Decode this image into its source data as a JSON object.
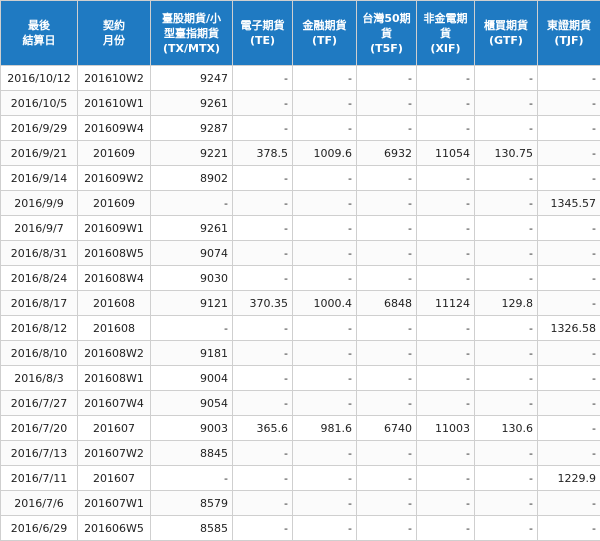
{
  "headers": [
    {
      "lines": [
        "最後",
        "結算日"
      ]
    },
    {
      "lines": [
        "契約",
        "月份"
      ]
    },
    {
      "lines": [
        "臺股期貨/小",
        "型臺指期貨",
        "(TX/MTX)"
      ]
    },
    {
      "lines": [
        "電子期貨",
        "(TE)"
      ]
    },
    {
      "lines": [
        "金融期貨",
        "(TF)"
      ]
    },
    {
      "lines": [
        "台灣50期",
        "貨",
        "(T5F)"
      ]
    },
    {
      "lines": [
        "非金電期",
        "貨",
        "(XIF)"
      ]
    },
    {
      "lines": [
        "櫃買期貨",
        "(GTF)"
      ]
    },
    {
      "lines": [
        "東證期貨",
        "(TJF)"
      ]
    }
  ],
  "rows": [
    [
      "2016/10/12",
      "201610W2",
      "9247",
      "-",
      "-",
      "-",
      "-",
      "-",
      "-"
    ],
    [
      "2016/10/5",
      "201610W1",
      "9261",
      "-",
      "-",
      "-",
      "-",
      "-",
      "-"
    ],
    [
      "2016/9/29",
      "201609W4",
      "9287",
      "-",
      "-",
      "-",
      "-",
      "-",
      "-"
    ],
    [
      "2016/9/21",
      "201609",
      "9221",
      "378.5",
      "1009.6",
      "6932",
      "11054",
      "130.75",
      "-"
    ],
    [
      "2016/9/14",
      "201609W2",
      "8902",
      "-",
      "-",
      "-",
      "-",
      "-",
      "-"
    ],
    [
      "2016/9/9",
      "201609",
      "-",
      "-",
      "-",
      "-",
      "-",
      "-",
      "1345.57"
    ],
    [
      "2016/9/7",
      "201609W1",
      "9261",
      "-",
      "-",
      "-",
      "-",
      "-",
      "-"
    ],
    [
      "2016/8/31",
      "201608W5",
      "9074",
      "-",
      "-",
      "-",
      "-",
      "-",
      "-"
    ],
    [
      "2016/8/24",
      "201608W4",
      "9030",
      "-",
      "-",
      "-",
      "-",
      "-",
      "-"
    ],
    [
      "2016/8/17",
      "201608",
      "9121",
      "370.35",
      "1000.4",
      "6848",
      "11124",
      "129.8",
      "-"
    ],
    [
      "2016/8/12",
      "201608",
      "-",
      "-",
      "-",
      "-",
      "-",
      "-",
      "1326.58"
    ],
    [
      "2016/8/10",
      "201608W2",
      "9181",
      "-",
      "-",
      "-",
      "-",
      "-",
      "-"
    ],
    [
      "2016/8/3",
      "201608W1",
      "9004",
      "-",
      "-",
      "-",
      "-",
      "-",
      "-"
    ],
    [
      "2016/7/27",
      "201607W4",
      "9054",
      "-",
      "-",
      "-",
      "-",
      "-",
      "-"
    ],
    [
      "2016/7/20",
      "201607",
      "9003",
      "365.6",
      "981.6",
      "6740",
      "11003",
      "130.6",
      "-"
    ],
    [
      "2016/7/13",
      "201607W2",
      "8845",
      "-",
      "-",
      "-",
      "-",
      "-",
      "-"
    ],
    [
      "2016/7/11",
      "201607",
      "-",
      "-",
      "-",
      "-",
      "-",
      "-",
      "1229.9"
    ],
    [
      "2016/7/6",
      "201607W1",
      "8579",
      "-",
      "-",
      "-",
      "-",
      "-",
      "-"
    ],
    [
      "2016/6/29",
      "201606W5",
      "8585",
      "-",
      "-",
      "-",
      "-",
      "-",
      "-"
    ]
  ]
}
